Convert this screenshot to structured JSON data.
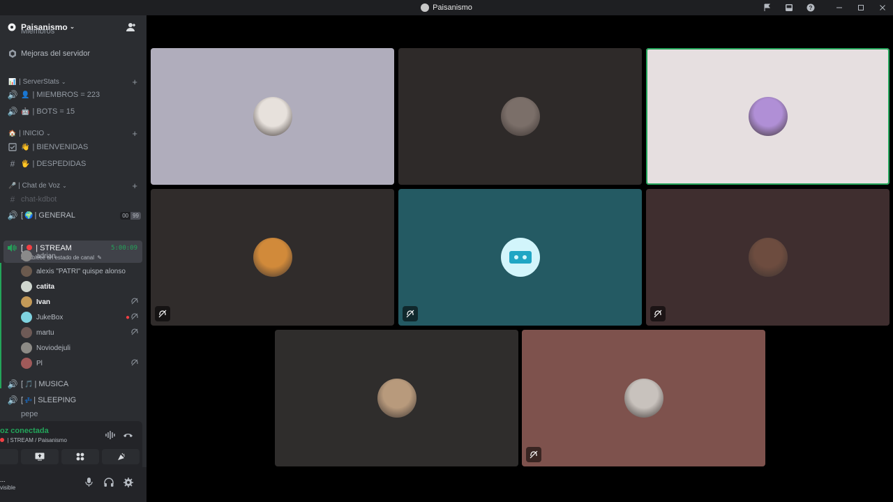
{
  "window": {
    "title": "Paisanismo",
    "icons": [
      "flag-icon",
      "inbox-icon",
      "help-icon",
      "minimize-icon",
      "maximize-icon",
      "close-icon"
    ]
  },
  "server": {
    "name": "Paisanismo",
    "clipped_item": "Miembros",
    "boost_item": "Mejoras del servidor"
  },
  "categories": {
    "serverstats": "| ServerStats",
    "inicio": "| INICIO",
    "chat_voz": "| Chat de Voz"
  },
  "channels": {
    "miembros": "| MIEMBROS = 223",
    "bots": "| BOTS = 15",
    "bienvenidas": "| BIENVENIDAS",
    "despedidas": "| DESPEDIDAS",
    "chat_kdbot": "chat-kdbot",
    "general": "| GENERAL",
    "general_prefix": "[",
    "general_pill_a": "00",
    "general_pill_b": "99",
    "stream": "| STREAM",
    "stream_prefix": "[",
    "stream_timer": "5:00:09",
    "stream_status": "Establece un estado de canal",
    "musica": "| MUSICA",
    "musica_prefix": "[",
    "sleeping": "| SLEEPING",
    "sleeping_prefix": "[",
    "pepe": "pepe"
  },
  "voice_members": [
    {
      "name": "adrian",
      "bold": false,
      "icons": []
    },
    {
      "name": "alexis \"PATRI\" quispe alonso",
      "bold": false,
      "icons": []
    },
    {
      "name": "catita",
      "bold": true,
      "icons": []
    },
    {
      "name": "Ivan",
      "bold": true,
      "icons": [
        "deafened-icon"
      ]
    },
    {
      "name": "JukeBox",
      "bold": false,
      "icons": [
        "streaming-icon",
        "deafened-icon"
      ]
    },
    {
      "name": "martu",
      "bold": false,
      "icons": [
        "deafened-icon"
      ]
    },
    {
      "name": "Noviodejuli",
      "bold": false,
      "icons": []
    },
    {
      "name": "Pl",
      "bold": false,
      "icons": [
        "deafened-icon"
      ]
    }
  ],
  "voice_panel": {
    "status": "oz conectada",
    "location": "| STREAM / Paisanismo"
  },
  "user_panel": {
    "name": "...",
    "status": "visible"
  },
  "colors": {
    "accent_green": "#23a55a",
    "sidebar": "#2b2d31",
    "tiles": [
      "#b0adbc",
      "#2e2a29",
      "#e6dfe0",
      "#302c2b",
      "#245a63",
      "#3f2e2f",
      "#2f2d2c",
      "#7e524d"
    ]
  }
}
